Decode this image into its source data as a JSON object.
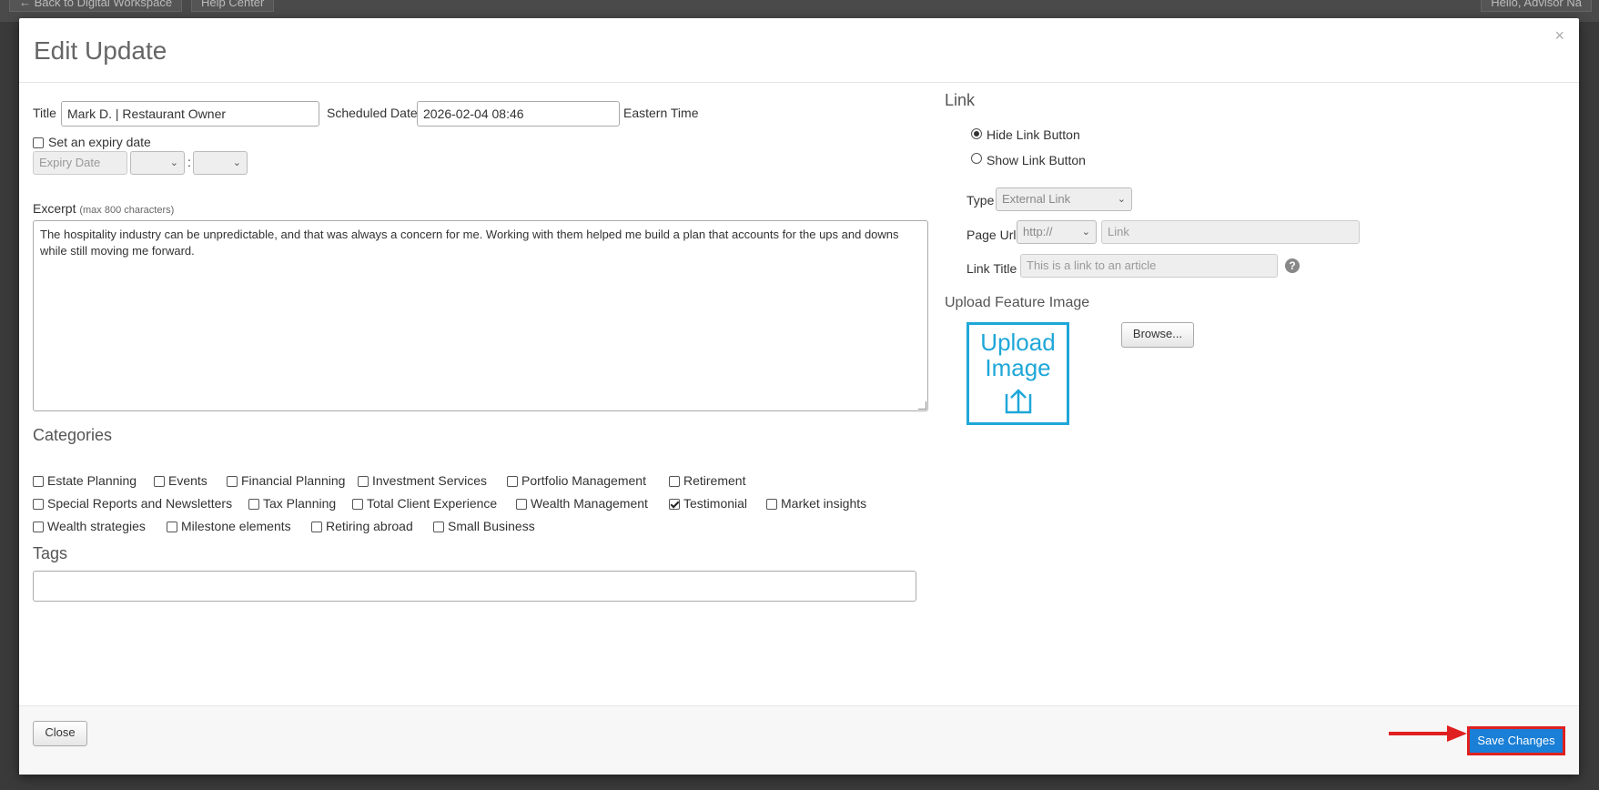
{
  "background": {
    "back_link": "← Back to Digital Workspace",
    "help_link": "Help Center",
    "greeting": "Hello, Advisor Na"
  },
  "modal": {
    "title": "Edit Update",
    "close_glyph": "×"
  },
  "form": {
    "title_label": "Title",
    "title_value": "Mark D. | Restaurant Owner",
    "scheduled_label": "Scheduled Date",
    "scheduled_value": "2026-02-04 08:46",
    "timezone": "Eastern Time",
    "expiry_checkbox_label": "Set an expiry date",
    "expiry_checked": false,
    "expiry_placeholder": "Expiry Date",
    "time_separator": ":",
    "excerpt_label": "Excerpt",
    "excerpt_hint": "(max 800 characters)",
    "excerpt_value": "The hospitality industry can be unpredictable, and that was always a concern for me. Working with them helped me build a plan that accounts for the ups and downs while still moving me forward.",
    "categories_title": "Categories",
    "categories": [
      {
        "label": "Estate Planning",
        "checked": false
      },
      {
        "label": "Events",
        "checked": false
      },
      {
        "label": "Financial Planning",
        "checked": false
      },
      {
        "label": "Investment Services",
        "checked": false
      },
      {
        "label": "Portfolio Management",
        "checked": false
      },
      {
        "label": "Retirement",
        "checked": false
      },
      {
        "label": "Special Reports and Newsletters",
        "checked": false
      },
      {
        "label": "Tax Planning",
        "checked": false
      },
      {
        "label": "Total Client Experience",
        "checked": false
      },
      {
        "label": "Wealth Management",
        "checked": false
      },
      {
        "label": "Testimonial",
        "checked": true
      },
      {
        "label": "Market insights",
        "checked": false
      },
      {
        "label": "Wealth strategies",
        "checked": false
      },
      {
        "label": "Milestone elements",
        "checked": false
      },
      {
        "label": "Retiring abroad",
        "checked": false
      },
      {
        "label": "Small Business",
        "checked": false
      }
    ],
    "tags_title": "Tags",
    "tags_value": ""
  },
  "link": {
    "title": "Link",
    "hide_label": "Hide Link Button",
    "show_label": "Show Link Button",
    "selected": "hide",
    "type_label": "Type",
    "type_value": "External Link",
    "page_url_label": "Page Url",
    "protocol_value": "http://",
    "link_placeholder": "Link",
    "link_title_label": "Link Title",
    "link_title_placeholder": "This is a link to an article",
    "help_glyph": "?"
  },
  "upload": {
    "title": "Upload Feature Image",
    "box_line1": "Upload",
    "box_line2": "Image",
    "browse_label": "Browse..."
  },
  "footer": {
    "close_label": "Close",
    "save_label": "Save Changes",
    "arrow_color": "#e02020",
    "save_color": "#1a7fd6"
  }
}
